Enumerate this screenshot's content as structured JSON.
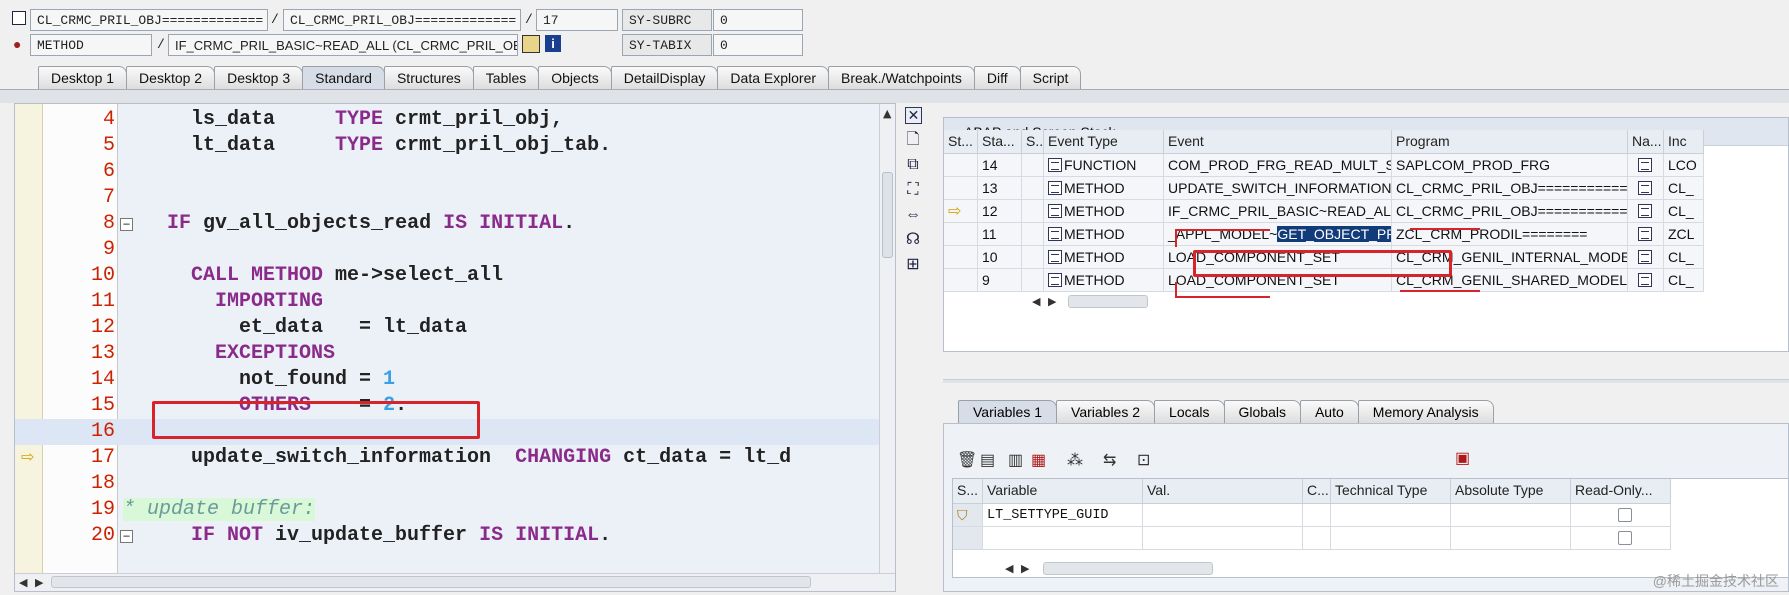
{
  "header": {
    "row1": {
      "field1": "CL_CRMC_PRIL_OBJ=============",
      "sep": "/",
      "field2": "CL_CRMC_PRIL_OBJ=============",
      "sep2": "/",
      "line": "17",
      "sysvar_label": "SY-SUBRC",
      "sysvar_value": "0"
    },
    "row2": {
      "type": "METHOD",
      "sep": "/",
      "method": "IF_CRMC_PRIL_BASIC~READ_ALL (CL_CRMC_PRIL_OBJ)",
      "sysvar_label": "SY-TABIX",
      "sysvar_value": "0"
    }
  },
  "tabs": [
    "Desktop 1",
    "Desktop 2",
    "Desktop 3",
    "Standard",
    "Structures",
    "Tables",
    "Objects",
    "DetailDisplay",
    "Data Explorer",
    "Break./Watchpoints",
    "Diff",
    "Script"
  ],
  "active_tab": "Standard",
  "code": {
    "lines": [
      {
        "n": "4",
        "parts": [
          [
            "",
            "    ls_data     "
          ],
          [
            "kw",
            "TYPE "
          ],
          [
            "",
            "crmt_pril_obj,"
          ]
        ]
      },
      {
        "n": "5",
        "parts": [
          [
            "",
            "    lt_data     "
          ],
          [
            "kw",
            "TYPE "
          ],
          [
            "",
            "crmt_pril_obj_tab."
          ]
        ]
      },
      {
        "n": "6",
        "parts": []
      },
      {
        "n": "7",
        "parts": []
      },
      {
        "n": "8",
        "parts": [
          [
            "",
            "  "
          ],
          [
            "kw",
            "IF "
          ],
          [
            "",
            "gv_all_objects_read "
          ],
          [
            "kw",
            "IS INITIAL"
          ],
          [
            "",
            "."
          ]
        ]
      },
      {
        "n": "9",
        "parts": []
      },
      {
        "n": "10",
        "parts": [
          [
            "kw",
            "    CALL METHOD "
          ],
          [
            "",
            "me->select_all"
          ]
        ]
      },
      {
        "n": "11",
        "parts": [
          [
            "kw",
            "      IMPORTING"
          ]
        ]
      },
      {
        "n": "12",
        "parts": [
          [
            "",
            "        et_data   = lt_data"
          ]
        ]
      },
      {
        "n": "13",
        "parts": [
          [
            "kw",
            "      EXCEPTIONS"
          ]
        ]
      },
      {
        "n": "14",
        "parts": [
          [
            "",
            "        not_found = "
          ],
          [
            "num",
            "1"
          ]
        ]
      },
      {
        "n": "15",
        "parts": [
          [
            "kw",
            "        OTHERS    "
          ],
          [
            "",
            "= "
          ],
          [
            "num",
            "2"
          ],
          [
            "",
            "."
          ]
        ]
      },
      {
        "n": "16",
        "parts": []
      },
      {
        "n": "17",
        "parts": [
          [
            "",
            "    update_switch_information  "
          ],
          [
            "kw",
            "CHANGING "
          ],
          [
            "",
            "ct_data = lt_d"
          ]
        ]
      },
      {
        "n": "18",
        "parts": []
      },
      {
        "n": "19",
        "parts": [
          [
            "cmt",
            "* update buffer:"
          ]
        ]
      },
      {
        "n": "20",
        "parts": [
          [
            "kw",
            "    IF NOT "
          ],
          [
            "",
            "iv_update_buffer "
          ],
          [
            "kw",
            "IS INITIAL"
          ],
          [
            "",
            "."
          ]
        ]
      }
    ]
  },
  "stack": {
    "title": "ABAP and Screen Stack",
    "columns": [
      "St...",
      "Sta...",
      "S..",
      "Event Type",
      "Event",
      "Program",
      "Na...",
      "Inc"
    ],
    "rows": [
      {
        "sta": "14",
        "type": "FUNCTION",
        "event": "COM_PROD_FRG_READ_MULT_SET",
        "program": "SAPLCOM_PROD_FRG",
        "inc": "LCO"
      },
      {
        "sta": "13",
        "type": "METHOD",
        "event": "UPDATE_SWITCH_INFORMATION",
        "program": "CL_CRMC_PRIL_OBJ===========",
        "inc": "CL_"
      },
      {
        "sta": "12",
        "type": "METHOD",
        "event": "IF_CRMC_PRIL_BASIC~READ_ALL",
        "program": "CL_CRMC_PRIL_OBJ===========",
        "inc": "CL_"
      },
      {
        "sta": "11",
        "type": "METHOD",
        "event_pre": "_APPL_MODEL~",
        "event_hl": "GET_OBJECT_PROPS",
        "program": "ZCL_CRM_PRODIL========",
        "inc": "ZCL"
      },
      {
        "sta": "10",
        "type": "METHOD",
        "event": "LOAD_COMPONENT_SET",
        "program": "CL_CRM_GENIL_INTERNAL_MODEL=",
        "inc": "CL_"
      },
      {
        "sta": "9",
        "type": "METHOD",
        "event": "LOAD_COMPONENT_SET",
        "program": "CL_CRM_GENIL_SHARED_MODEL===",
        "inc": "CL_"
      }
    ]
  },
  "var_tabs": [
    "Variables 1",
    "Variables 2",
    "Locals",
    "Globals",
    "Auto",
    "Memory Analysis"
  ],
  "variables": {
    "columns": [
      "S...",
      "Variable",
      "Val.",
      "C...",
      "Technical Type",
      "Absolute Type",
      "Read-Only..."
    ],
    "rows": [
      {
        "variable": "LT_SETTYPE_GUID"
      }
    ]
  },
  "watermark": "@稀土掘金技术社区"
}
